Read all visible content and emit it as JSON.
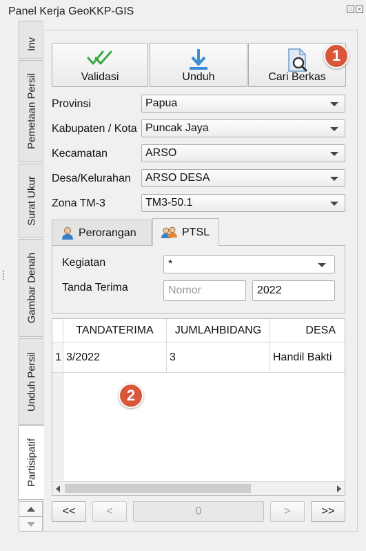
{
  "panel": {
    "title": "Panel Kerja GeoKKP-GIS"
  },
  "side_tabs": [
    {
      "label": "Inv"
    },
    {
      "label": "Pemetaan Persil"
    },
    {
      "label": "Surat Ukur"
    },
    {
      "label": "Gambar Denah"
    },
    {
      "label": "Unduh Persil"
    },
    {
      "label": "Partisipatif",
      "active": true
    }
  ],
  "toolbar": {
    "validasi": "Validasi",
    "unduh": "Unduh",
    "cari_berkas": "Cari Berkas"
  },
  "annotations": {
    "one": "1",
    "two": "2"
  },
  "form": {
    "provinsi": {
      "label": "Provinsi",
      "value": "Papua"
    },
    "kabupaten": {
      "label": "Kabupaten / Kota",
      "value": "Puncak Jaya"
    },
    "kecamatan": {
      "label": "Kecamatan",
      "value": "ARSO"
    },
    "desa": {
      "label": "Desa/Kelurahan",
      "value": "ARSO DESA"
    },
    "zona": {
      "label": "Zona TM-3",
      "value": "TM3-50.1"
    }
  },
  "tabs": [
    {
      "label": "Perorangan",
      "icon": "person-icon"
    },
    {
      "label": "PTSL",
      "icon": "group-icon",
      "active": true
    }
  ],
  "ptsl": {
    "kegiatan_label": "Kegiatan",
    "kegiatan_value": "*",
    "tanda_terima_label": "Tanda Terima",
    "nomor_placeholder": "Nomor",
    "tahun_value": "2022"
  },
  "table": {
    "columns": [
      "TANDATERIMA",
      "JUMLAHBIDANG",
      "DESA"
    ],
    "rows": [
      {
        "index": "1",
        "cells": [
          "3/2022",
          "3",
          "Handil Bakti"
        ]
      }
    ]
  },
  "pager": {
    "first": "<<",
    "prev": "<",
    "page": "0",
    "next": ">",
    "last": ">>"
  },
  "colors": {
    "accent_green": "#3aa845",
    "accent_blue": "#3a8fd8",
    "badge": "#d8563a"
  }
}
